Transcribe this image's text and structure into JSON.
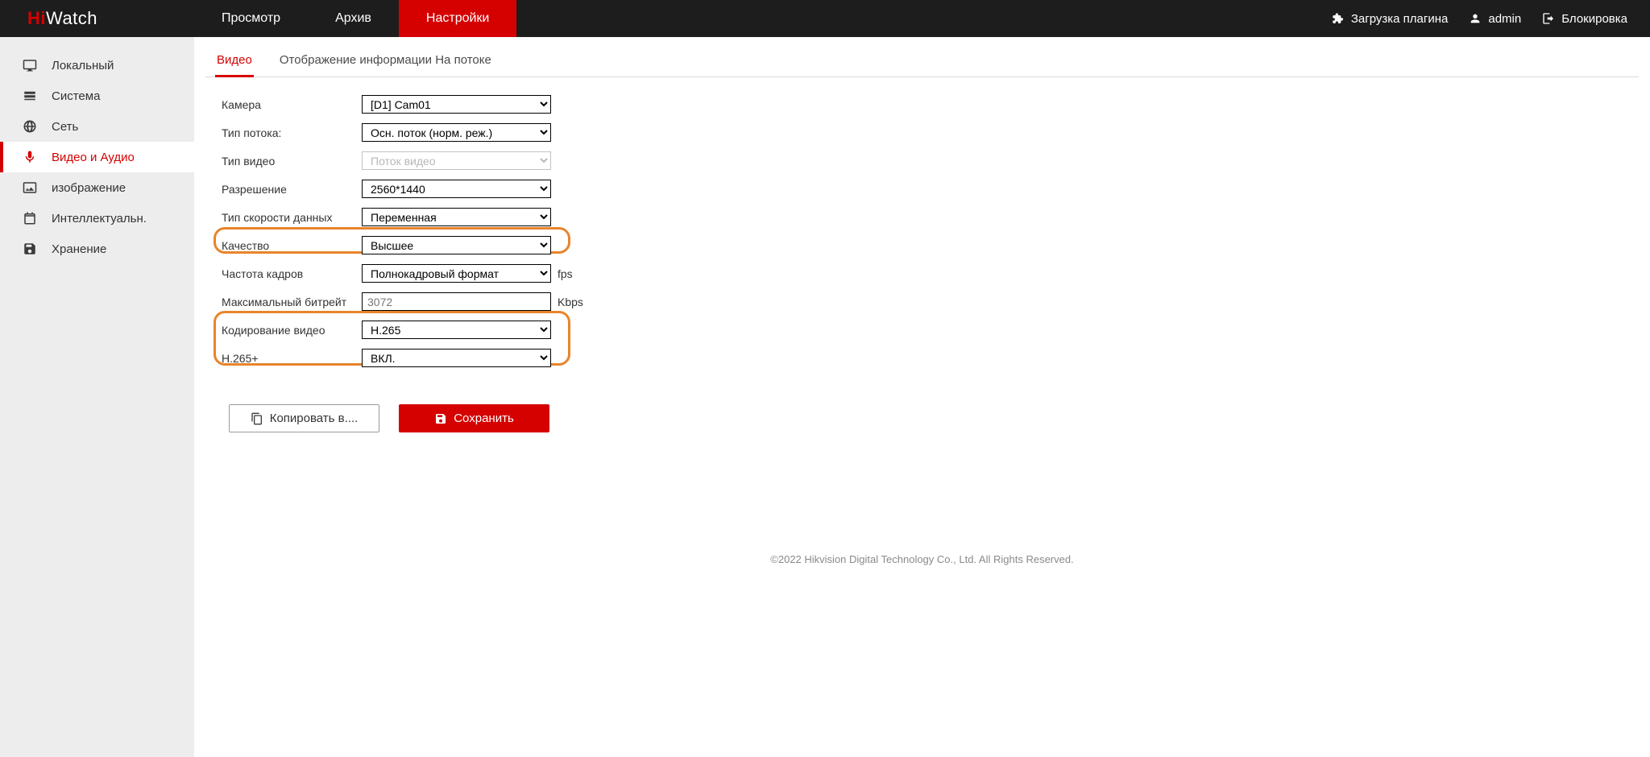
{
  "brand": {
    "hi": "Hi",
    "watch": "Watch"
  },
  "topnav": {
    "preview": "Просмотр",
    "archive": "Архив",
    "settings": "Настройки"
  },
  "topright": {
    "plugin": "Загрузка плагина",
    "user": "admin",
    "lock": "Блокировка"
  },
  "sidebar": {
    "local": "Локальный",
    "system": "Система",
    "network": "Сеть",
    "video_audio": "Видео и Аудио",
    "image": "изображение",
    "intel": "Интеллектуальн.",
    "storage": "Хранение"
  },
  "subtabs": {
    "video": "Видео",
    "stream_info": "Отображение информации На потоке"
  },
  "labels": {
    "camera": "Камера",
    "stream_type": "Тип потока:",
    "video_type": "Тип видео",
    "resolution": "Разрешение",
    "bitrate_type": "Тип скорости данных",
    "quality": "Качество",
    "frame_rate": "Частота кадров",
    "max_bitrate": "Максимальный битрейт",
    "encoding": "Кодирование видео",
    "h265plus": "H.265+"
  },
  "values": {
    "camera": "[D1] Cam01",
    "stream_type": "Осн. поток (норм. реж.)",
    "video_type": "Поток видео",
    "resolution": "2560*1440",
    "bitrate_type": "Переменная",
    "quality": "Высшее",
    "frame_rate": "Полнокадровый формат",
    "max_bitrate": "3072",
    "encoding": "H.265",
    "h265plus": "ВКЛ."
  },
  "units": {
    "fps": "fps",
    "kbps": "Kbps"
  },
  "buttons": {
    "copy_to": "Копировать в....",
    "save": "Сохранить"
  },
  "footer": "©2022 Hikvision Digital Technology Co., Ltd. All Rights Reserved."
}
